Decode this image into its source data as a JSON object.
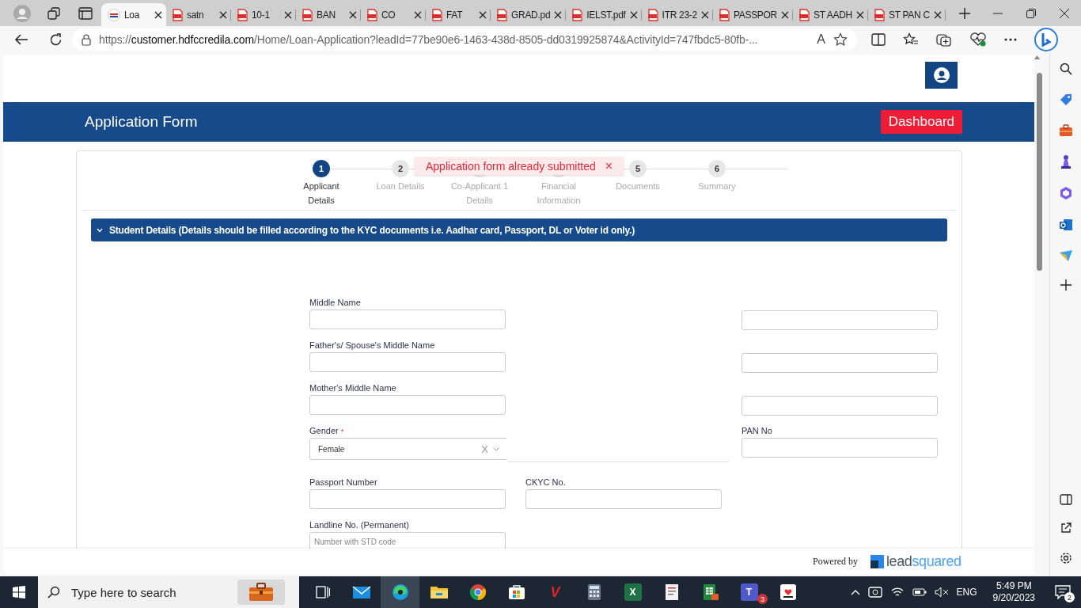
{
  "browser": {
    "tabs": [
      {
        "label": "Loa",
        "kind": "site",
        "selected": true
      },
      {
        "label": "satn",
        "kind": "pdf",
        "selected": false
      },
      {
        "label": "10-1",
        "kind": "pdf",
        "selected": false
      },
      {
        "label": "BAN",
        "kind": "pdf",
        "selected": false
      },
      {
        "label": "CO",
        "kind": "pdf",
        "selected": false
      },
      {
        "label": "FAT",
        "kind": "pdf",
        "selected": false
      },
      {
        "label": "GRAD.pd",
        "kind": "pdf",
        "selected": false
      },
      {
        "label": "IELST.pdf",
        "kind": "pdf",
        "selected": false
      },
      {
        "label": "ITR 23-2",
        "kind": "pdf",
        "selected": false
      },
      {
        "label": "PASSPOR",
        "kind": "pdf",
        "selected": false
      },
      {
        "label": "ST AADH",
        "kind": "pdf",
        "selected": false
      },
      {
        "label": "ST PAN C",
        "kind": "pdf",
        "selected": false
      }
    ],
    "url": {
      "scheme": "https://",
      "host": "customer.hdfccredila.com",
      "path": "/Home/Loan-Application?leadId=77be90e6-1463-438d-8505-dd0319925874&ActivityId=747fbdc5-80fb-..."
    },
    "read_aloud_glyph": "A"
  },
  "page": {
    "header_title": "Application Form",
    "dashboard_button": "Dashboard",
    "steps": [
      {
        "number": "1",
        "label": "Applicant Details",
        "current": true
      },
      {
        "number": "2",
        "label": "Loan Details",
        "current": false
      },
      {
        "label": "Co-Applicant 1 Details",
        "current": false
      },
      {
        "label": "Financial Information",
        "current": false
      },
      {
        "number": "5",
        "label": "Documents",
        "current": false
      },
      {
        "number": "6",
        "label": "Summary",
        "current": false
      }
    ],
    "toast": {
      "message": "Application form already submitted",
      "close": "×"
    },
    "section": {
      "title": "Student Details (Details should be filled according to the KYC documents i.e. Aadhar card, Passport, DL or Voter id only.)",
      "expanded": true
    },
    "form_rows": [
      [
        {
          "label": "Middle Name",
          "kind": "text"
        },
        null,
        {
          "kind": "text"
        }
      ],
      [
        {
          "label": "Father's/ Spouse's Middle Name",
          "kind": "text"
        },
        null,
        {
          "kind": "text"
        }
      ],
      [
        {
          "label": "Mother's Middle Name",
          "kind": "text"
        },
        null,
        {
          "kind": "text"
        }
      ],
      [
        {
          "label": "Gender",
          "required_mark": "*",
          "kind": "select",
          "value": "Female",
          "clear": "X"
        },
        null,
        {
          "label": "PAN No",
          "kind": "text"
        }
      ],
      [
        {
          "label": "Passport Number",
          "kind": "text"
        },
        {
          "label": "CKYC No.",
          "kind": "text"
        },
        null
      ],
      [
        {
          "label": "Landline No. (Permanent)",
          "kind": "text",
          "placeholder": "Number with STD code"
        },
        null,
        null
      ]
    ],
    "footer": {
      "powered_by": "Powered by",
      "brand_lead": "lead",
      "brand_squared": "squared"
    }
  },
  "taskbar": {
    "search_placeholder": "Type here to search",
    "apps": [
      {
        "kind": "taskview",
        "active": false
      },
      {
        "kind": "mail",
        "active": false
      },
      {
        "kind": "edge",
        "active": true
      },
      {
        "kind": "explorer",
        "active": false
      },
      {
        "kind": "chrome",
        "active": false
      },
      {
        "kind": "store",
        "active": false
      },
      {
        "kind": "vk",
        "icon_text": "V",
        "active": false
      },
      {
        "kind": "calculator",
        "active": false
      },
      {
        "kind": "excel",
        "icon_text": "X",
        "active": false
      },
      {
        "kind": "viewer",
        "active": false
      },
      {
        "kind": "sheets",
        "active": false
      },
      {
        "kind": "teams",
        "icon_text": "T",
        "badge": "3",
        "active": false
      },
      {
        "kind": "ilovepdf",
        "active": false
      }
    ],
    "language": "ENG",
    "time": "5:49 PM",
    "date": "9/20/2023",
    "notifications": "2"
  }
}
